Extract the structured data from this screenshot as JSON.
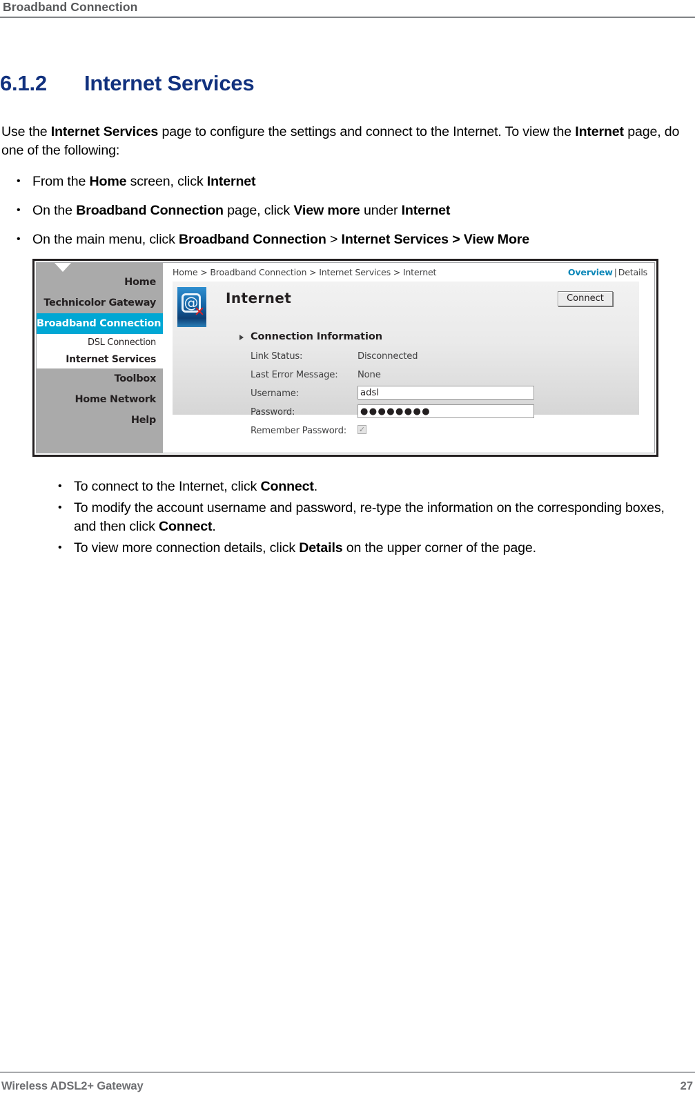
{
  "header": {
    "title": "Broadband Connection"
  },
  "heading": {
    "number": "6.1.2",
    "text": "Internet Services"
  },
  "intro": {
    "line1_a": "Use the ",
    "line1_b": "Internet Services",
    "line1_c": " page to configure the settings and connect to the Internet. To view the ",
    "line1_d": "Internet",
    "line1_e": " page, do one of the following:"
  },
  "bullets_top": [
    {
      "p1": "From the ",
      "b1": "Home",
      "p2": " screen, click ",
      "b2": "Internet",
      "p3": ""
    },
    {
      "p1": "On the ",
      "b1": "Broadband Connection",
      "p2": " page, click ",
      "b2": "View more",
      "p3": " under ",
      "b3": "Internet",
      "p4": ""
    },
    {
      "p1": "On the main menu, click ",
      "b1": "Broadband Connection",
      "p2": " > ",
      "b2": "Internet Services > View More",
      "p3": ""
    }
  ],
  "bullets_bottom": [
    {
      "p1": "To connect to the Internet, click ",
      "b1": "Connect",
      "p2": "."
    },
    {
      "p1": "To modify the account username and password, re-type the information on the corresponding boxes, and then click ",
      "b1": "Connect",
      "p2": "."
    },
    {
      "p1": "To view more connection details, click ",
      "b1": "Details",
      "p2": " on the upper corner of the page."
    }
  ],
  "screenshot": {
    "sidebar": {
      "items": [
        {
          "label": "Home",
          "active": false
        },
        {
          "label": "Technicolor Gateway",
          "active": false
        },
        {
          "label": "Broadband Connection",
          "active": true
        }
      ],
      "sub_items": [
        {
          "label": "DSL Connection",
          "current": false
        },
        {
          "label": "Internet Services",
          "current": true
        }
      ],
      "items_after": [
        {
          "label": "Toolbox",
          "active": false
        },
        {
          "label": "Home Network",
          "active": false
        },
        {
          "label": "Help",
          "active": false
        }
      ]
    },
    "breadcrumb": "Home > Broadband Connection > Internet Services > Internet",
    "view_links": {
      "overview": "Overview",
      "separator": "|",
      "details": "Details"
    },
    "panel": {
      "icon_glyph": "@",
      "icon_badge": "✕",
      "title": "Internet",
      "connect_button": "Connect",
      "section_title": "Connection Information",
      "fields": [
        {
          "label": "Link Status:",
          "value": "Disconnected",
          "type": "text"
        },
        {
          "label": "Last Error Message:",
          "value": "None",
          "type": "text"
        },
        {
          "label": "Username:",
          "value": "adsl",
          "type": "input"
        },
        {
          "label": "Password:",
          "value": "●●●●●●●●",
          "type": "password"
        },
        {
          "label": "Remember Password:",
          "value": "✓",
          "type": "checkbox"
        }
      ]
    },
    "colors": {
      "accent": "#00a7d4",
      "link": "#0b87b8",
      "sidebar_bg": "#aaaaaa"
    }
  },
  "footer": {
    "left": "Wireless ADSL2+ Gateway",
    "right": "27"
  },
  "theme": {
    "heading_blue": "#11317e",
    "header_gray": "#58595b",
    "footer_gray": "#6d6e71"
  }
}
